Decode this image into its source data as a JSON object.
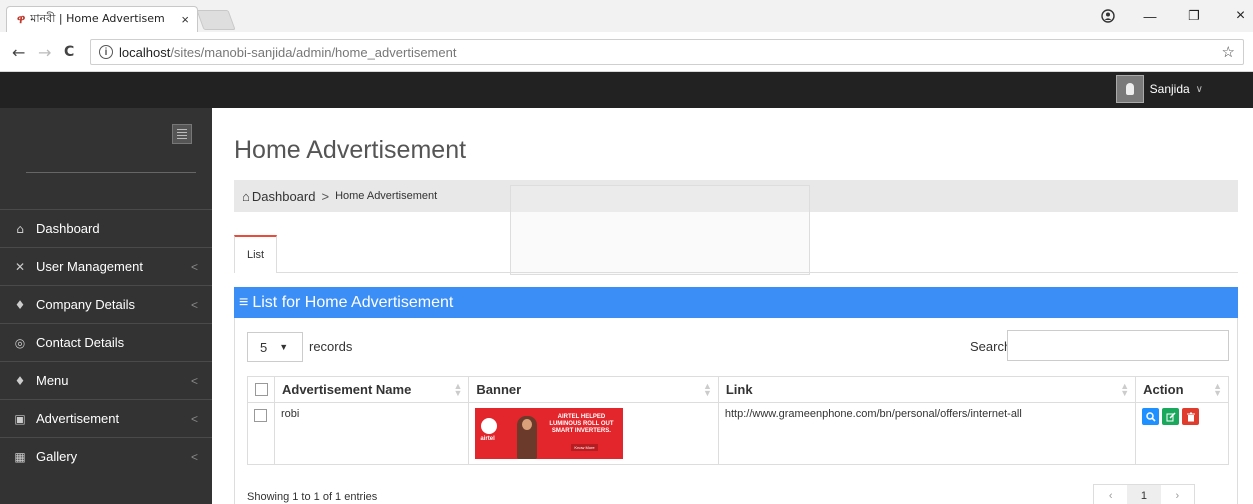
{
  "browser": {
    "tab_favicon": "ዋ",
    "tab_title": "মানবী | Home Advertisem",
    "tab_close": "×",
    "back": "←",
    "forward": "→",
    "reload": "C",
    "info": "i",
    "url_host": "localhost",
    "url_path": "/sites/manobi-sanjida/admin/home_advertisement",
    "star": "☆",
    "profile_icon": "person-circle-icon",
    "minimize": "—",
    "restore": "❐",
    "close": "×"
  },
  "topnav": {
    "username": "Sanjida",
    "chevron": "∨"
  },
  "sidebar": {
    "items": [
      {
        "label": "Dashboard",
        "icon": "⌂",
        "has_arrow": false
      },
      {
        "label": "User Management",
        "icon": "✕",
        "has_arrow": true
      },
      {
        "label": "Company Details",
        "icon": "♦",
        "has_arrow": true
      },
      {
        "label": "Contact Details",
        "icon": "◎",
        "has_arrow": false
      },
      {
        "label": "Menu",
        "icon": "♦",
        "has_arrow": true
      },
      {
        "label": "Advertisement",
        "icon": "▣",
        "has_arrow": true
      },
      {
        "label": "Gallery",
        "icon": "▦",
        "has_arrow": true
      }
    ],
    "arrow": "<"
  },
  "page": {
    "title": "Home Advertisement",
    "breadcrumb_home": "Dashboard",
    "breadcrumb_sep": ">",
    "breadcrumb_current": "Home Advertisement",
    "tab_list": "List",
    "panel_title": "List for Home Advertisement",
    "panel_icon": "≡"
  },
  "table_controls": {
    "length_value": "5",
    "length_caret": "▼",
    "length_label": "records",
    "search_label": "Search:",
    "search_value": ""
  },
  "table": {
    "headers": [
      "Advertisement Name",
      "Banner",
      "Link",
      "Action"
    ],
    "rows": [
      {
        "name": "robi",
        "banner": {
          "logo_text": "airtel",
          "headline": "AIRTEL HELPED LUMINOUS ROLL OUT SMART INVERTERS.",
          "cta": "Know More"
        },
        "link": "http://www.grameenphone.com/bn/personal/offers/internet-all"
      }
    ]
  },
  "footer": {
    "info": "Showing 1 to 1 of 1 entries",
    "prev": "‹",
    "page": "1",
    "next": "›"
  },
  "colors": {
    "panel_header": "#3b8ef5",
    "topbar": "#222222",
    "sidebar": "#333333",
    "tab_accent": "#e74c3c",
    "btn_view": "#1e90ff",
    "btn_edit": "#1aa85c",
    "btn_delete": "#e03c2e"
  }
}
